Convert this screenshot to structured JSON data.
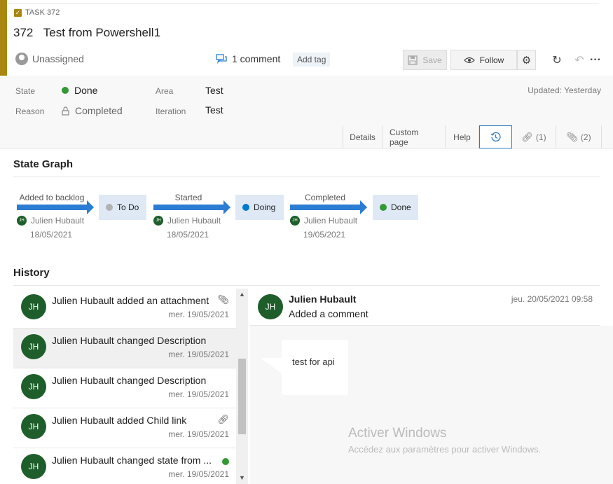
{
  "workitem": {
    "type_label": "TASK 372",
    "id": "372",
    "title": "Test from Powershell1",
    "assignee": "Unassigned",
    "comment_count_label": "1 comment",
    "add_tag_label": "Add tag",
    "accent_color": "#a8860f"
  },
  "toolbar": {
    "save_label": "Save",
    "follow_label": "Follow",
    "settings_icon": "gear-icon",
    "refresh_icon": "refresh-icon",
    "undo_icon": "undo-icon",
    "more_icon": "more-icon"
  },
  "fields": {
    "state_label": "State",
    "state_value": "Done",
    "state_color": "#339933",
    "reason_label": "Reason",
    "reason_value": "Completed",
    "area_label": "Area",
    "area_value": "Test",
    "iteration_label": "Iteration",
    "iteration_value": "Test",
    "updated": "Updated: Yesterday"
  },
  "tabs": [
    {
      "label": "Details"
    },
    {
      "label": "Custom page"
    },
    {
      "label": "Help"
    },
    {
      "label": "",
      "icon": "history-icon"
    },
    {
      "label": "(1)",
      "icon": "link-icon"
    },
    {
      "label": "(2)",
      "icon": "attachment-icon"
    }
  ],
  "state_graph": {
    "title": "State Graph",
    "transitions": [
      {
        "label": "Added to backlog",
        "actor": "Julien Hubault",
        "actor_initials": "JH",
        "date": "18/05/2021",
        "to_state": "To Do",
        "to_color": "#b2b2b2"
      },
      {
        "label": "Started",
        "actor": "Julien Hubault",
        "actor_initials": "JH",
        "date": "18/05/2021",
        "to_state": "Doing",
        "to_color": "#007acc"
      },
      {
        "label": "Completed",
        "actor": "Julien Hubault",
        "actor_initials": "JH",
        "date": "19/05/2021",
        "to_state": "Done",
        "to_color": "#339933"
      }
    ]
  },
  "history": {
    "title": "History",
    "items": [
      {
        "initials": "JH",
        "text": "Julien Hubault added an attachment",
        "date": "mer. 19/05/2021",
        "icon": "attachment-icon"
      },
      {
        "initials": "JH",
        "text": "Julien Hubault changed Description",
        "date": "mer. 19/05/2021",
        "icon": ""
      },
      {
        "initials": "JH",
        "text": "Julien Hubault changed Description",
        "date": "mer. 19/05/2021",
        "icon": ""
      },
      {
        "initials": "JH",
        "text": "Julien Hubault added Child link",
        "date": "mer. 19/05/2021",
        "icon": "link-icon"
      },
      {
        "initials": "JH",
        "text": "Julien Hubault changed state from ...",
        "date": "mer. 19/05/2021",
        "icon": "state-dot-icon"
      }
    ],
    "detail": {
      "initials": "JH",
      "name": "Julien Hubault",
      "action": "Added a comment",
      "date": "jeu. 20/05/2021 09:58",
      "comment": "test for api"
    }
  },
  "watermark": {
    "title": "Activer Windows",
    "subtitle": "Accédez aux paramètres pour activer Windows."
  }
}
